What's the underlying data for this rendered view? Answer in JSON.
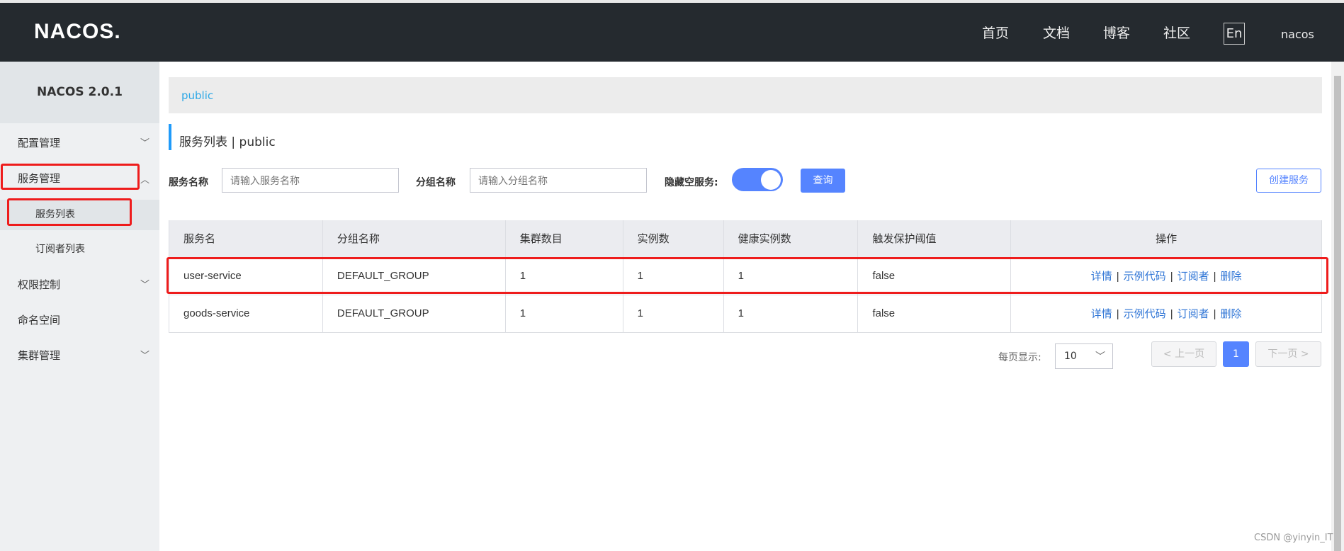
{
  "header": {
    "logo": "NACOS.",
    "nav": [
      "首页",
      "文档",
      "博客",
      "社区"
    ],
    "lang": "En",
    "user": "nacos"
  },
  "sidebar": {
    "title": "NACOS 2.0.1",
    "items": [
      {
        "label": "配置管理",
        "chevron": "down"
      },
      {
        "label": "服务管理",
        "chevron": "up"
      },
      {
        "label": "服务列表",
        "sub": true
      },
      {
        "label": "订阅者列表",
        "sub": true
      },
      {
        "label": "权限控制",
        "chevron": "down"
      },
      {
        "label": "命名空间"
      },
      {
        "label": "集群管理",
        "chevron": "down"
      }
    ]
  },
  "breadcrumb": "public",
  "page_title": "服务列表  |  public",
  "filters": {
    "service_name_label": "服务名称",
    "service_name_placeholder": "请输入服务名称",
    "group_name_label": "分组名称",
    "group_name_placeholder": "请输入分组名称",
    "hide_empty_label": "隐藏空服务:",
    "hide_empty_on": true,
    "query_button": "查询",
    "create_button": "创建服务"
  },
  "table": {
    "headers": [
      "服务名",
      "分组名称",
      "集群数目",
      "实例数",
      "健康实例数",
      "触发保护阈值",
      "操作"
    ],
    "rows": [
      [
        "user-service",
        "DEFAULT_GROUP",
        "1",
        "1",
        "1",
        "false"
      ],
      [
        "goods-service",
        "DEFAULT_GROUP",
        "1",
        "1",
        "1",
        "false"
      ]
    ],
    "actions": [
      "详情",
      "示例代码",
      "订阅者",
      "删除"
    ]
  },
  "pagination": {
    "per_page_label": "每页显示:",
    "per_page": "10",
    "prev": "< 上一页",
    "current": "1",
    "next": "下一页 >"
  },
  "watermark": "CSDN @yinyin_IT",
  "colors": {
    "header_bg": "#252a2f",
    "primary": "#5584ff",
    "link": "#2f75d6",
    "highlight": "#ee1c1c"
  }
}
